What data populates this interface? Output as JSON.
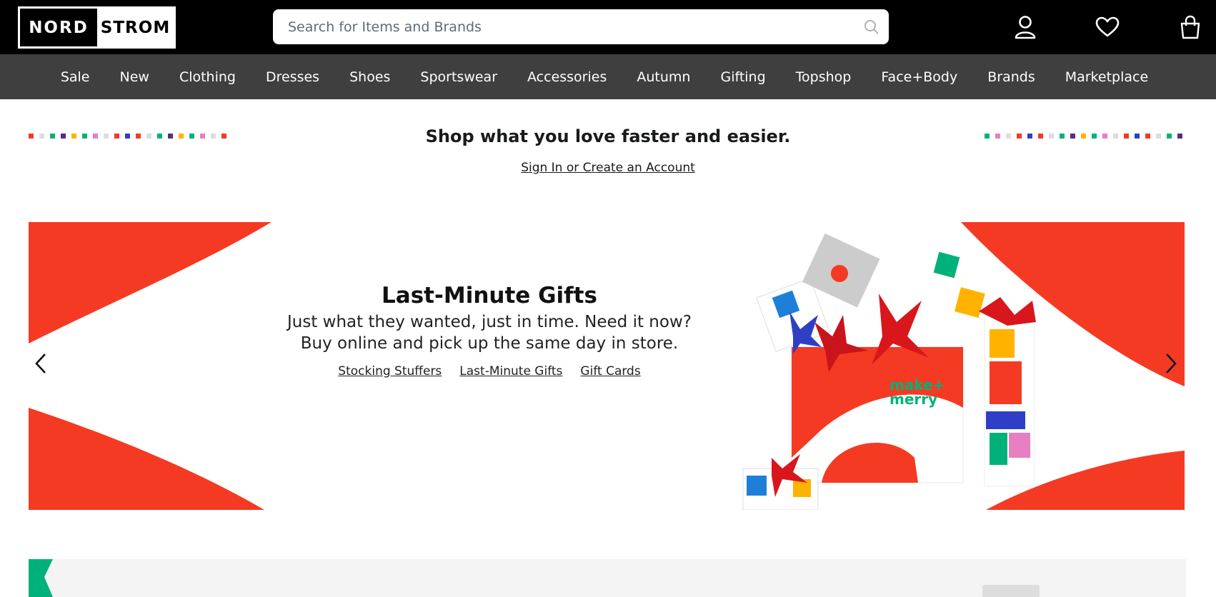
{
  "header": {
    "logo_left": "NORD",
    "logo_right": "STROM",
    "search_placeholder": "Search for Items and Brands",
    "icons": [
      "search-icon",
      "account-icon",
      "heart-icon",
      "bag-icon"
    ]
  },
  "nav": {
    "items": [
      "Sale",
      "New",
      "Clothing",
      "Dresses",
      "Shoes",
      "Sportswear",
      "Accessories",
      "Autumn",
      "Gifting",
      "Topshop",
      "Face+Body",
      "Brands",
      "Marketplace"
    ]
  },
  "promo": {
    "title": "Shop what you love faster and easier.",
    "signin_link": "Sign In or Create an Account"
  },
  "hero": {
    "title": "Last-Minute Gifts",
    "line1": "Just what they wanted, just in time. Need it now?",
    "line2": "Buy online and pick up the same day in store.",
    "links": [
      "Stocking Stuffers",
      "Last-Minute Gifts",
      "Gift Cards"
    ],
    "bag_text": "make merry"
  },
  "colors": {
    "accent_red": "#f53a23",
    "teal": "#00b27a",
    "nav_bg": "#3f3f3f"
  }
}
